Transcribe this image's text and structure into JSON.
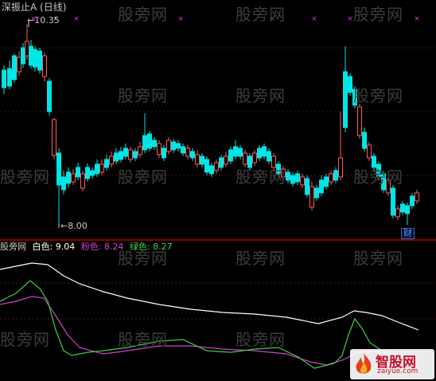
{
  "top_chart": {
    "title": "深振止A (日线)",
    "high_label": "10.35",
    "low_label": "8.00",
    "tag_label": "财",
    "colors": {
      "up": "#ff5a5a",
      "down": "#00e5e5",
      "title": "#c8c8c8",
      "divider": "#c00000",
      "grid": "#5a1010"
    }
  },
  "bottom_chart": {
    "name_label": "股旁网",
    "white_label": "白色",
    "white_value": "9.04",
    "pink_label": "粉色",
    "pink_value": "8.24",
    "green_label": "绿色",
    "green_value": "8.27",
    "colors": {
      "white": "#ffffff",
      "pink": "#d040d0",
      "green": "#40d040"
    }
  },
  "watermark": "股旁网",
  "badge": {
    "title": "智股网",
    "url": "zaiyue.com"
  },
  "marker_glyph": "×"
}
